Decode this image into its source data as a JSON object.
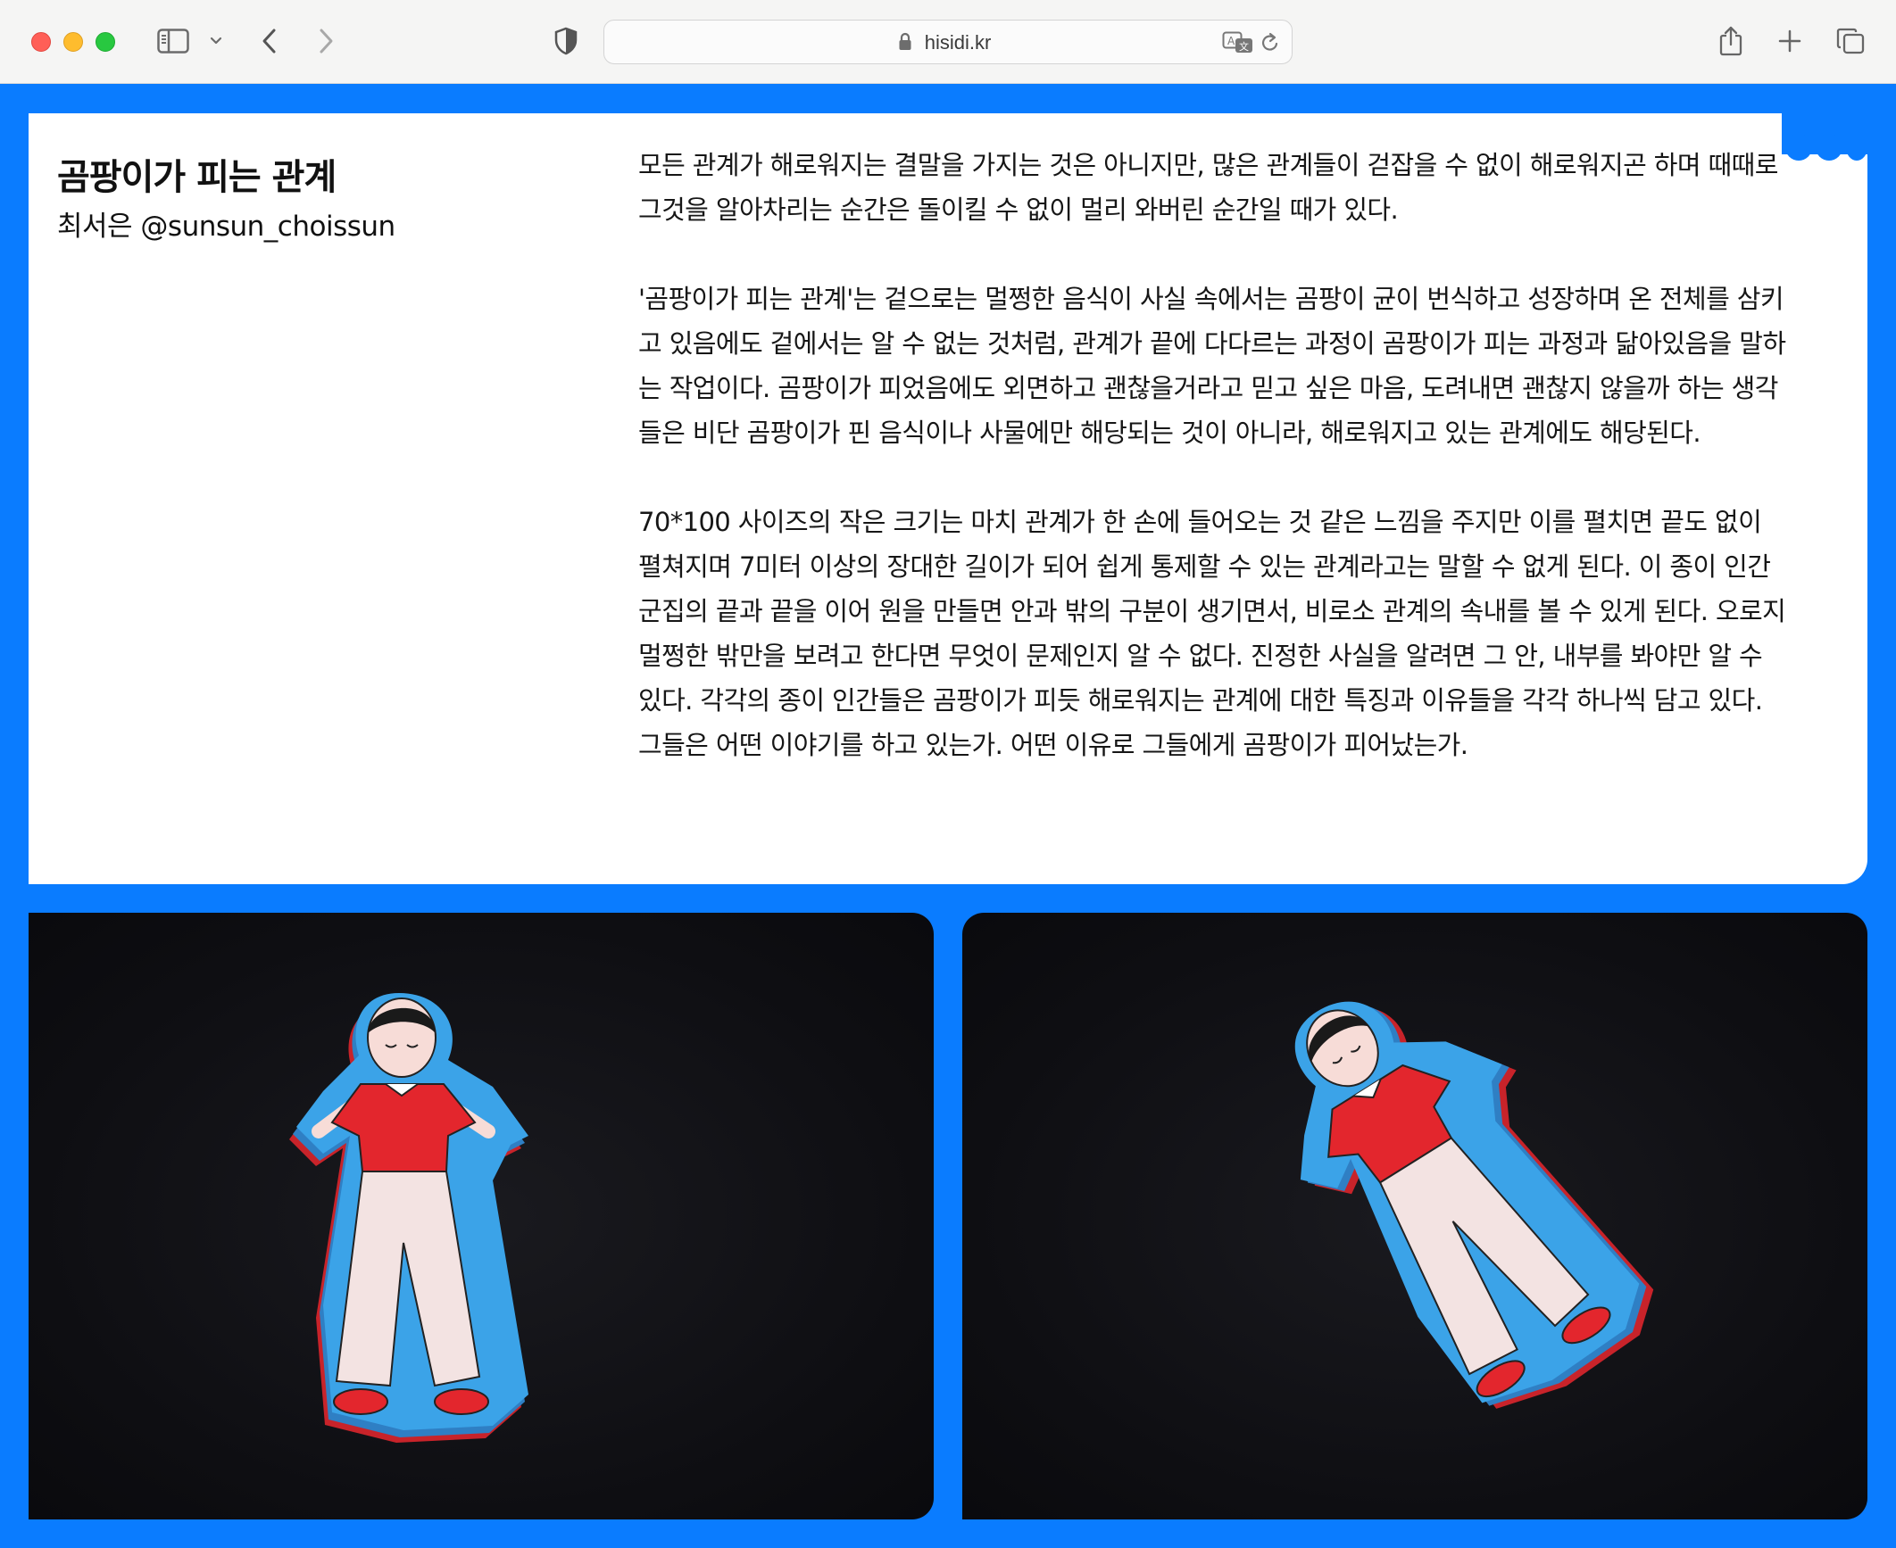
{
  "browser": {
    "url": "hisidi.kr"
  },
  "article": {
    "title": "곰팡이가 피는 관계",
    "author": "최서은 @sunsun_choissun",
    "paragraphs": [
      "모든 관계가 해로워지는 결말을 가지는 것은 아니지만, 많은 관계들이 걷잡을 수 없이 해로워지곤 하며 때때로 그것을 알아차리는 순간은 돌이킬 수 없이 멀리 와버린 순간일 때가 있다.",
      "'곰팡이가 피는 관계'는 겉으로는 멀쩡한 음식이 사실 속에서는 곰팡이 균이 번식하고 성장하며 온 전체를 삼키고 있음에도 겉에서는 알 수 없는 것처럼, 관계가 끝에 다다르는 과정이 곰팡이가 피는 과정과 닮아있음을 말하는 작업이다. 곰팡이가 피었음에도 외면하고 괜찮을거라고 믿고 싶은 마음, 도려내면 괜찮지 않을까 하는 생각들은 비단 곰팡이가 핀 음식이나 사물에만 해당되는 것이 아니라, 해로워지고 있는 관계에도 해당된다.",
      "70*100 사이즈의 작은 크기는 마치 관계가 한 손에 들어오는 것 같은 느낌을 주지만 이를 펼치면 끝도 없이 펼쳐지며 7미터 이상의 장대한 길이가 되어 쉽게 통제할 수 있는 관계라고는 말할 수 없게 된다. 이 종이 인간 군집의 끝과 끝을 이어 원을 만들면 안과 밖의 구분이 생기면서, 비로소 관계의 속내를 볼 수 있게 된다. 오로지 멀쩡한 밖만을 보려고 한다면 무엇이 문제인지 알 수 없다. 진정한 사실을 알려면 그 안, 내부를 봐야만 알 수 있다. 각각의 종이 인간들은 곰팡이가 피듯 해로워지는 관계에 대한 특징과 이유들을 각각 하나씩 담고 있다. 그들은 어떤 이야기를 하고 있는가. 어떤 이유로 그들에게 곰팡이가 피어났는가."
    ]
  },
  "colors": {
    "page_background": "#0a7cff",
    "card_background": "#ffffff",
    "photo_background": "#0e0e12",
    "figure_blue": "#3ba3e8",
    "figure_red": "#e3262d",
    "figure_pants": "#f3e3e2"
  },
  "icons": [
    "sidebar-icon",
    "chevron-down-icon",
    "back-icon",
    "forward-icon",
    "shield-icon",
    "lock-icon",
    "translate-icon",
    "reload-icon",
    "share-icon",
    "plus-icon",
    "tabs-icon"
  ]
}
